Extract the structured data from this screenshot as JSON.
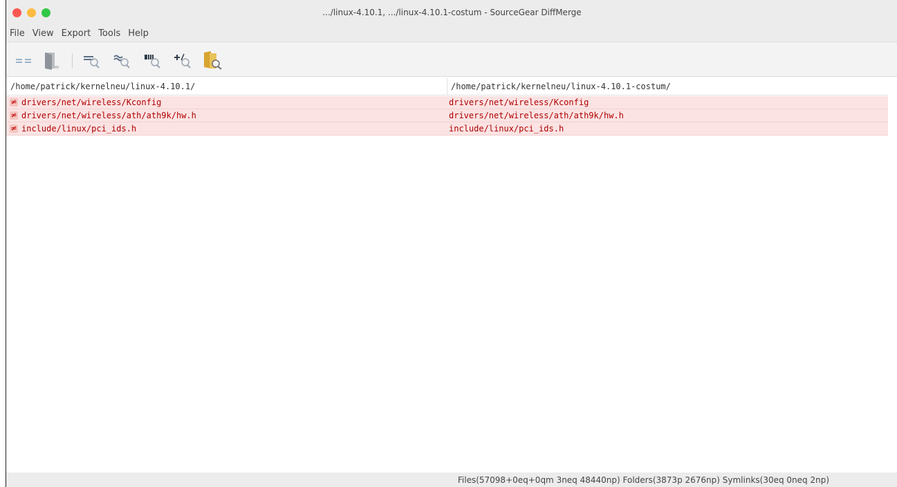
{
  "window": {
    "title": ".../linux-4.10.1, .../linux-4.10.1-costum - SourceGear DiffMerge"
  },
  "menu": [
    "File",
    "View",
    "Export",
    "Tools",
    "Help"
  ],
  "toolbar": {
    "buttons": [
      {
        "icon": "compare-icon"
      },
      {
        "icon": "door-icon"
      },
      {
        "icon": "show-equal-icon"
      },
      {
        "icon": "show-similar-icon"
      },
      {
        "icon": "show-quick-match-icon"
      },
      {
        "icon": "show-peerless-icon"
      },
      {
        "icon": "folder-search-icon"
      }
    ]
  },
  "header": {
    "left_path": "/home/patrick/kernelneu/linux-4.10.1/",
    "right_path": "/home/patrick/kernelneu/linux-4.10.1-costum/"
  },
  "rows": [
    {
      "status_icon": "not-equal-icon",
      "left": "drivers/net/wireless/Kconfig",
      "right": "drivers/net/wireless/Kconfig"
    },
    {
      "status_icon": "not-equal-icon",
      "left": "drivers/net/wireless/ath/ath9k/hw.h",
      "right": "drivers/net/wireless/ath/ath9k/hw.h"
    },
    {
      "status_icon": "not-equal-icon",
      "left": "include/linux/pci_ids.h",
      "right": "include/linux/pci_ids.h"
    }
  ],
  "status": {
    "summary": "Files(57098+0eq+0qm 3neq 48440np) Folders(3873p 2676np) Symlinks(30eq 0neq 2np)"
  },
  "colors": {
    "diff_row_bg": "#fbe3e3",
    "diff_text": "#b00000",
    "close": "#fc5753",
    "minimize": "#fdbc40",
    "maximize": "#33c748"
  }
}
